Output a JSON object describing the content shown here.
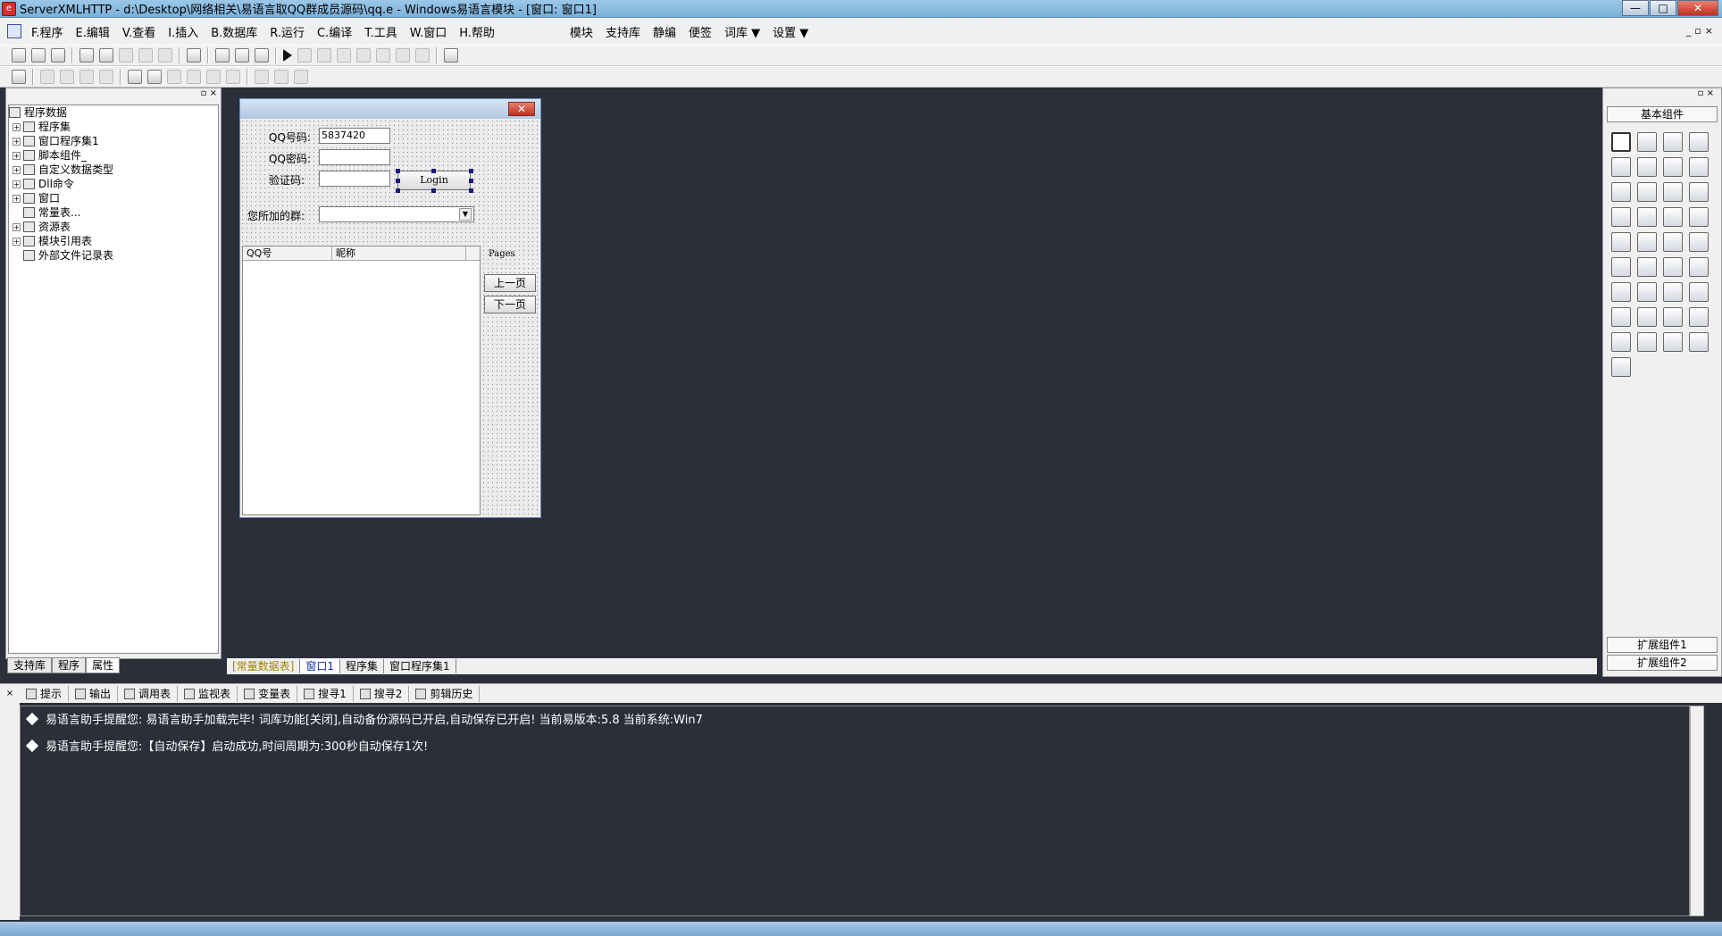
{
  "window": {
    "title": "ServerXMLHTTP - d:\\Desktop\\网络相关\\易语言取QQ群成员源码\\qq.e - Windows易语言模块 - [窗口: 窗口1]",
    "controls": {
      "minimize": "—",
      "maximize": "□",
      "close": "✕"
    }
  },
  "menu": {
    "items": [
      {
        "key": "F",
        "label": "F.程序"
      },
      {
        "key": "E",
        "label": "E.编辑"
      },
      {
        "key": "V",
        "label": "V.查看"
      },
      {
        "key": "I",
        "label": "I.插入"
      },
      {
        "key": "B",
        "label": "B.数据库"
      },
      {
        "key": "R",
        "label": "R.运行"
      },
      {
        "key": "C",
        "label": "C.编译"
      },
      {
        "key": "T",
        "label": "T.工具"
      },
      {
        "key": "W",
        "label": "W.窗口"
      },
      {
        "key": "H",
        "label": "H.帮助"
      }
    ],
    "extra": [
      "模块",
      "支持库",
      "静编",
      "便签",
      "词库 ▼",
      "设置 ▼"
    ]
  },
  "left_panel": {
    "tree": [
      {
        "label": "程序数据",
        "expander": ""
      },
      {
        "label": "程序集",
        "expander": "+"
      },
      {
        "label": "窗口程序集1",
        "expander": "+"
      },
      {
        "label": "脚本组件_",
        "expander": "+"
      },
      {
        "label": "自定义数据类型",
        "expander": "+"
      },
      {
        "label": "Dll命令",
        "expander": "+"
      },
      {
        "label": "窗口",
        "expander": "+"
      },
      {
        "label": "常量表...",
        "expander": ""
      },
      {
        "label": "资源表",
        "expander": "+"
      },
      {
        "label": "模块引用表",
        "expander": "+"
      },
      {
        "label": "外部文件记录表",
        "expander": ""
      }
    ],
    "tabs": [
      "支持库",
      "程序",
      "属性"
    ]
  },
  "form": {
    "qq_label": "QQ号码:",
    "qq_value": "5837420",
    "pwd_label": "QQ密码:",
    "code_label": "验证码:",
    "login_button": "Login",
    "group_label": "您所加的群:",
    "list_columns": [
      "QQ号",
      "昵称"
    ],
    "pages_label": "Pages",
    "prev_button": "上一页",
    "next_button": "下一页"
  },
  "right_panel": {
    "title": "基本组件",
    "component_count": 37,
    "ext1": "扩展组件1",
    "ext2": "扩展组件2"
  },
  "editor_tabs": [
    "[常量数据表]",
    "窗口1",
    "程序集",
    "窗口程序集1"
  ],
  "output_tabs": [
    "提示",
    "输出",
    "调用表",
    "监视表",
    "变量表",
    "搜寻1",
    "搜寻2",
    "剪辑历史"
  ],
  "output_lines": [
    "易语言助手提醒您:  易语言助手加载完毕!  词库功能[关闭],自动备份源码已开启,自动保存已开启!  当前易版本:5.8  当前系统:Win7",
    "易语言助手提醒您:【自动保存】启动成功,时间周期为:300秒自动保存1次!"
  ],
  "colors": {
    "workspace": "#2b2f3a",
    "panel": "#f0f0f0",
    "title_bar": "#9cc8e8"
  }
}
